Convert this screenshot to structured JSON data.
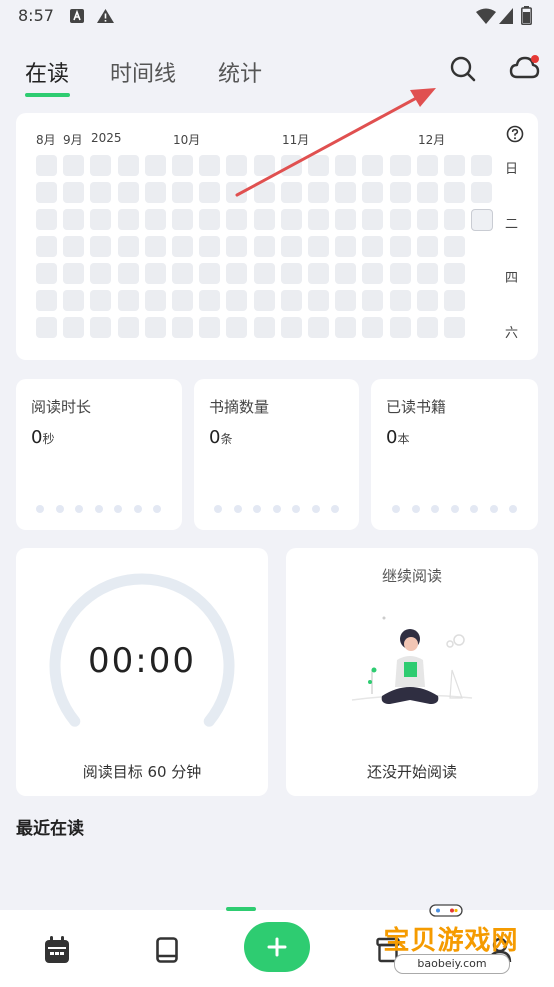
{
  "status_bar": {
    "time": "8:57"
  },
  "tabs": [
    {
      "label": "在读",
      "active": true
    },
    {
      "label": "时间线",
      "active": false
    },
    {
      "label": "统计",
      "active": false
    }
  ],
  "heatmap": {
    "months": [
      "8月",
      "9月",
      "2025",
      "10月",
      "11月",
      "12月"
    ],
    "weekdays": [
      "日",
      "二",
      "四",
      "六"
    ],
    "help_icon": "question-circle-icon"
  },
  "stats": [
    {
      "title": "阅读时长",
      "value": "0",
      "unit": "秒"
    },
    {
      "title": "书摘数量",
      "value": "0",
      "unit": "条"
    },
    {
      "title": "已读书籍",
      "value": "0",
      "unit": "本"
    }
  ],
  "timer": {
    "time": "00:00",
    "goal": "阅读目标 60 分钟"
  },
  "continue_reading": {
    "title": "继续阅读",
    "empty_text": "还没开始阅读"
  },
  "recent": {
    "title": "最近在读"
  },
  "nav": [
    "calendar-icon",
    "book-icon",
    "add-icon",
    "archive-icon",
    "profile-icon"
  ],
  "watermark": {
    "text": "宝贝游戏网",
    "url": "baobeiy.com"
  },
  "colors": {
    "accent": "#2ecc71",
    "background": "#f1f2f7",
    "card": "#ffffff",
    "arrow": "#e05050"
  }
}
